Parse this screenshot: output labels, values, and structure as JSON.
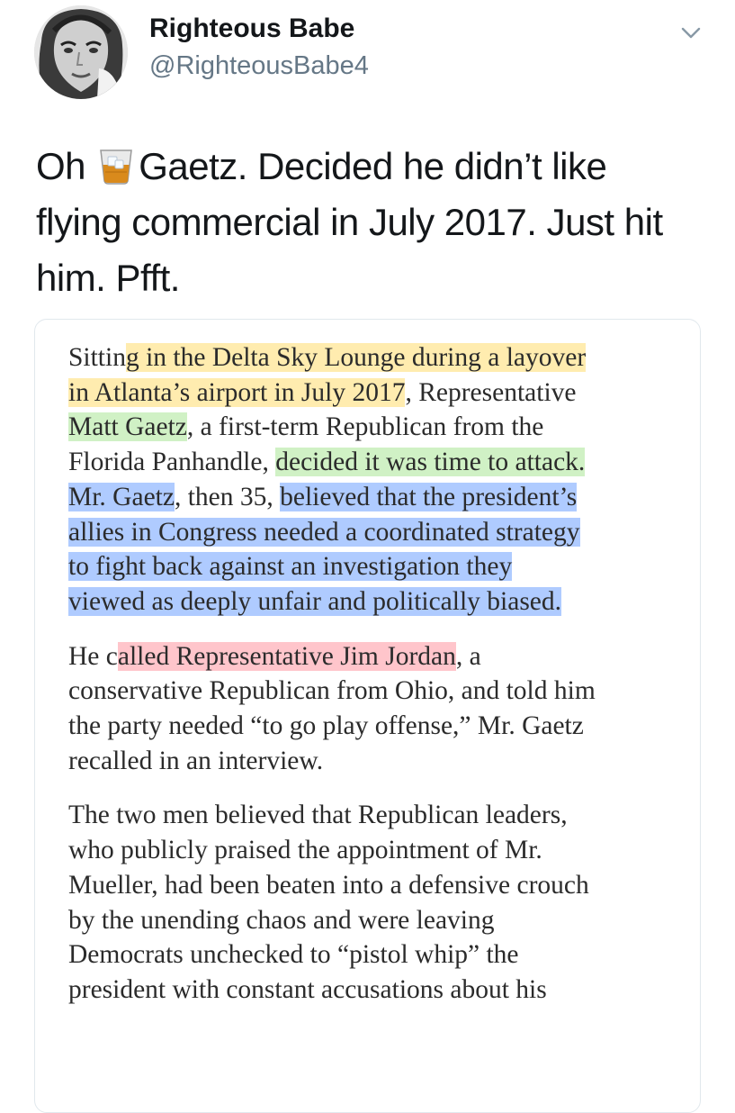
{
  "tweet": {
    "author_name": "Righteous Babe",
    "author_handle": "@RighteousBabe4",
    "avatar_icon": "portrait-avatar",
    "menu_icon": "chevron-down-icon",
    "emoji_icon": "tumbler-glass-emoji",
    "text_lines": {
      "l1_before": "Oh",
      "l1_after": "Gaetz. Decided he didn’t like",
      "l2": "flying commercial in July 2017. Just hit",
      "l3": "him. Pfft."
    }
  },
  "article": {
    "p1": [
      {
        "plain": "Sittin",
        "hl": "g in the Delta Sky Lounge during a layover",
        "rest": ""
      },
      {
        "plain": "",
        "hl": "in Atlanta’s airport in July 2017",
        "rest": ", Representative"
      },
      {
        "plain": "",
        "hl": "Matt Gaetz",
        "rest": ", a first-term Republican from the"
      },
      {
        "plain": "Florida Panhandle, ",
        "hl": "decided it was time to attack.",
        "rest": ""
      },
      {
        "plain": "",
        "hl": "Mr. Gaetz",
        "rest": ", then 35, ",
        "hl2": "believed that the president’s"
      },
      {
        "plain": "",
        "hl": "allies in Congress needed a coordinated strategy",
        "rest": ""
      },
      {
        "plain": "",
        "hl": "to fight back against an investigation they",
        "rest": ""
      },
      {
        "plain": "",
        "hl": "viewed as deeply unfair and politically biased.",
        "rest": ""
      }
    ],
    "p2": [
      {
        "plain": "He c",
        "hl": "alled Representative Jim Jordan",
        "rest": ", a"
      },
      {
        "plain": "conservative Republican from Ohio, and told him",
        "hl": "",
        "rest": ""
      },
      {
        "plain": "the party needed “to go play offense,” Mr. Gaetz",
        "hl": "",
        "rest": ""
      },
      {
        "plain": "recalled in an interview.",
        "hl": "",
        "rest": ""
      }
    ],
    "p3": [
      "The two men believed that Republican leaders,",
      "who publicly praised the appointment of Mr.",
      "Mueller, had been beaten into a defensive crouch",
      "by the unending chaos and were leaving",
      "Democrats unchecked to “pistol whip” the",
      "president with constant accusations about his"
    ]
  },
  "highlight_colors": {
    "yellow": "#ffdd6e",
    "green": "#aae696",
    "blue": "#6ea0ff",
    "red": "#ff96a0"
  }
}
